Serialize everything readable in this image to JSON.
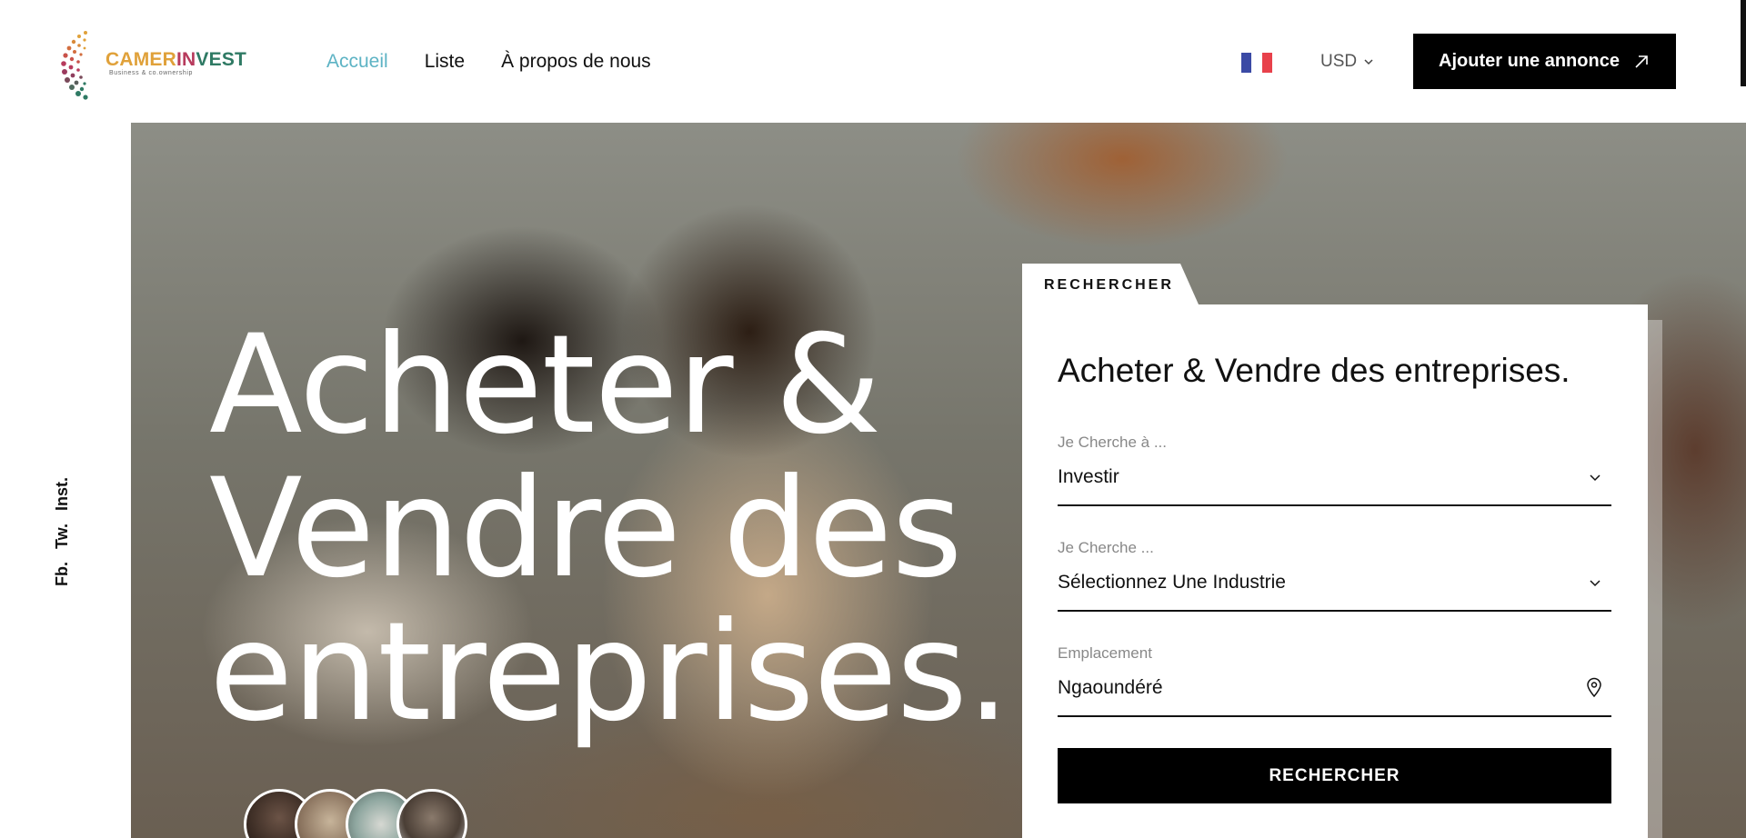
{
  "brand": {
    "name_part1": "CAMER",
    "name_part2": "IN",
    "name_part3": "VEST",
    "tagline": "Business & co.ownership",
    "colors": {
      "gold": "#e0a13a",
      "magenta": "#b73b5d",
      "green": "#2f7a64"
    }
  },
  "nav": {
    "items": [
      {
        "label": "Accueil",
        "active": true
      },
      {
        "label": "Liste",
        "active": false
      },
      {
        "label": "À propos de nous",
        "active": false
      }
    ],
    "active_color": "#5db3c4"
  },
  "header": {
    "language_flag": "flag-fr-icon",
    "currency": "USD",
    "add_button_label": "Ajouter une annonce"
  },
  "social": {
    "items": [
      "Fb.",
      "Tw.",
      "Inst."
    ]
  },
  "hero": {
    "title_lines": [
      "Acheter &",
      "Vendre des",
      "entreprises."
    ]
  },
  "search": {
    "tab_label": "RECHERCHER",
    "title": "Acheter & Vendre des entreprises.",
    "fields": [
      {
        "label": "Je Cherche à ...",
        "value": "Investir",
        "icon": "chevron-down-icon"
      },
      {
        "label": "Je Cherche ...",
        "value": "Sélectionnez Une Industrie",
        "icon": "chevron-down-icon"
      },
      {
        "label": "Emplacement",
        "value": "Ngaoundéré",
        "icon": "location-pin-icon"
      }
    ],
    "submit_label": "RECHERCHER"
  }
}
